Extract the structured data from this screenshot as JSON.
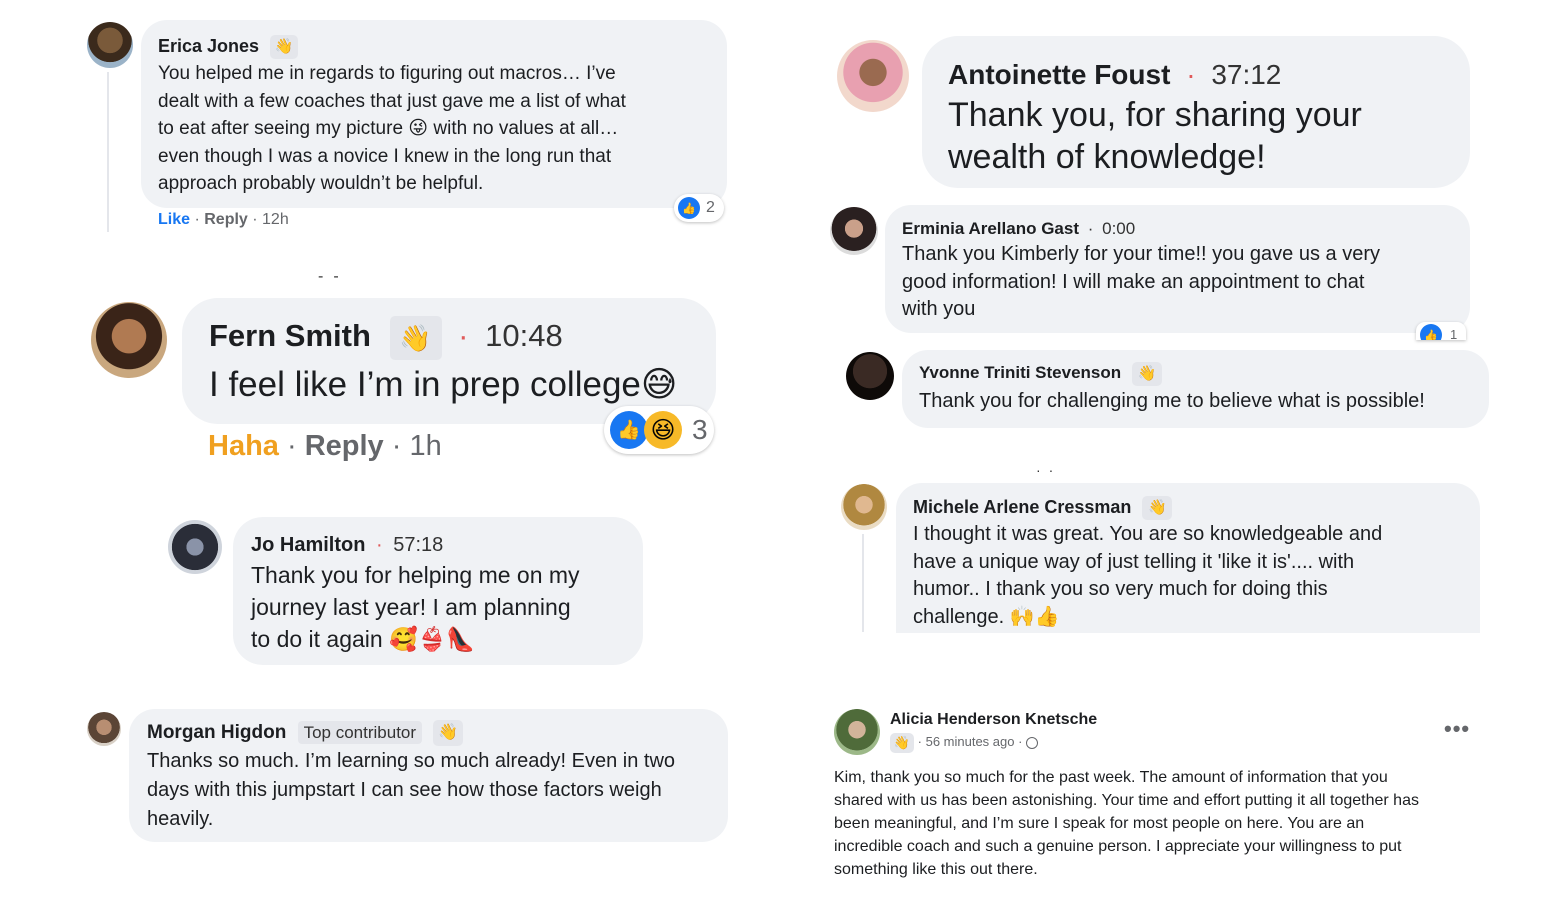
{
  "colors": {
    "bubble": "#f0f2f5",
    "like_blue": "#1877f2",
    "haha_orange": "#f7b928",
    "muted": "#65676b"
  },
  "icons": {
    "wave": "waving-hand-icon",
    "like": "like-reaction-icon",
    "haha": "haha-reaction-icon",
    "globe": "globe-icon",
    "more": "more-options-icon"
  },
  "erica": {
    "name": "Erica Jones",
    "lines": [
      "You helped me in regards to figuring out macros… I’ve",
      "dealt with a few coaches that just gave me a list of what",
      "to eat after seeing my picture",
      "with no values at all…",
      "even though I was a novice I knew in the long run that",
      "approach probably wouldn’t be helpful."
    ],
    "like": "Like",
    "reply": "Reply",
    "time": "12h",
    "reactions": "2"
  },
  "fern": {
    "name": "Fern Smith",
    "time": "10:48",
    "text": "I feel like I’m in prep college",
    "haha": "Haha",
    "reply": "Reply",
    "ago": "1h",
    "reactions": "3"
  },
  "jo": {
    "name": "Jo Hamilton",
    "time": "57:18",
    "lines": [
      "Thank you for helping me on my",
      "journey last year! I am planning",
      "to do it again"
    ]
  },
  "morgan": {
    "name": "Morgan Higdon",
    "badge": "Top contributor",
    "lines": [
      "Thanks so much. I’m learning so much already! Even in two",
      "days with this jumpstart I can see how those factors weigh",
      "heavily."
    ]
  },
  "antoinette": {
    "name": "Antoinette Foust",
    "time": "37:12",
    "lines": [
      "Thank you, for sharing your",
      "wealth of knowledge!"
    ]
  },
  "erminia": {
    "name": "Erminia Arellano Gast",
    "time": "0:00",
    "lines": [
      "Thank you Kimberly for your time!! you gave us a very",
      "good information! I will make an appointment to chat",
      "with you"
    ],
    "reactions": "1"
  },
  "yvonne": {
    "name": "Yvonne Triniti Stevenson",
    "text": "Thank you for challenging me to believe what is possible!"
  },
  "michele": {
    "name": "Michele Arlene Cressman",
    "lines": [
      "I thought it was great. You are so knowledgeable and",
      "have a unique way of just telling it 'like it is'.... with",
      "humor.. I thank you so very much for doing this",
      "challenge."
    ]
  },
  "alicia": {
    "name": "Alicia Henderson Knetsche",
    "time": "56 minutes ago",
    "lines": [
      "Kim, thank you so much for the past week. The amount of information that you",
      "shared with us has been astonishing. Your time and effort putting it all together has",
      "been meaningful, and I’m sure I speak for most people on here. You are an",
      "incredible coach and such a genuine person. I appreciate your willingness to put",
      "something like this out there."
    ]
  }
}
